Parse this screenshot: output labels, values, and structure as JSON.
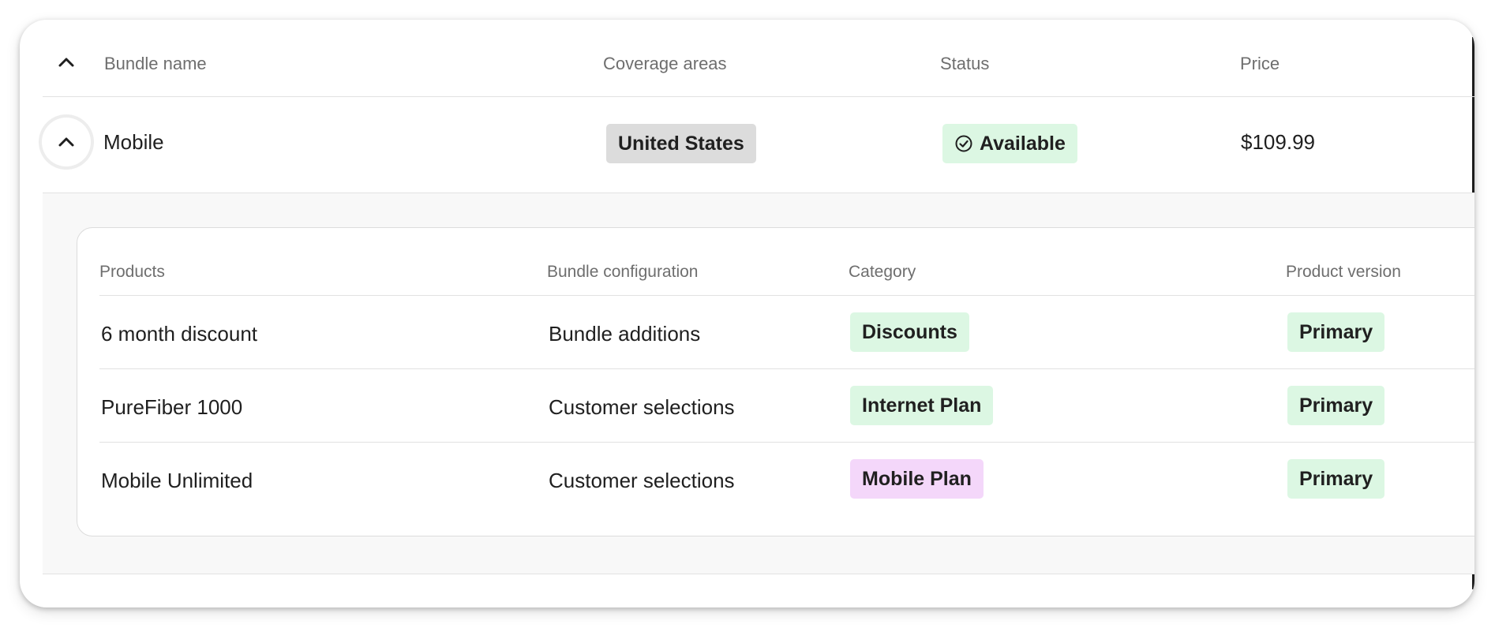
{
  "table": {
    "headers": {
      "bundle_name": "Bundle name",
      "coverage_areas": "Coverage areas",
      "status": "Status",
      "price": "Price"
    }
  },
  "bundle": {
    "name": "Mobile",
    "coverage": "United States",
    "status": "Available",
    "price": "$109.99"
  },
  "products_table": {
    "headers": {
      "products": "Products",
      "bundle_configuration": "Bundle configuration",
      "category": "Category",
      "product_version": "Product version"
    },
    "rows": [
      {
        "product": "6 month discount",
        "configuration": "Bundle additions",
        "category": "Discounts",
        "category_color": "#dcf7e3",
        "version": "Primary"
      },
      {
        "product": "PureFiber 1000",
        "configuration": "Customer selections",
        "category": "Internet Plan",
        "category_color": "#dcf7e3",
        "version": "Primary"
      },
      {
        "product": "Mobile Unlimited",
        "configuration": "Customer selections",
        "category": "Mobile Plan",
        "category_color": "#f4d7fa",
        "version": "Primary"
      }
    ]
  },
  "icons": {
    "collapse_all": "chevron-up-icon",
    "collapse_row": "chevron-up-icon",
    "status": "check-circle-icon"
  },
  "colors": {
    "status_available": "#dcf7e3",
    "coverage_badge": "#dcdcdc",
    "mobile_plan_badge": "#f4d7fa"
  }
}
